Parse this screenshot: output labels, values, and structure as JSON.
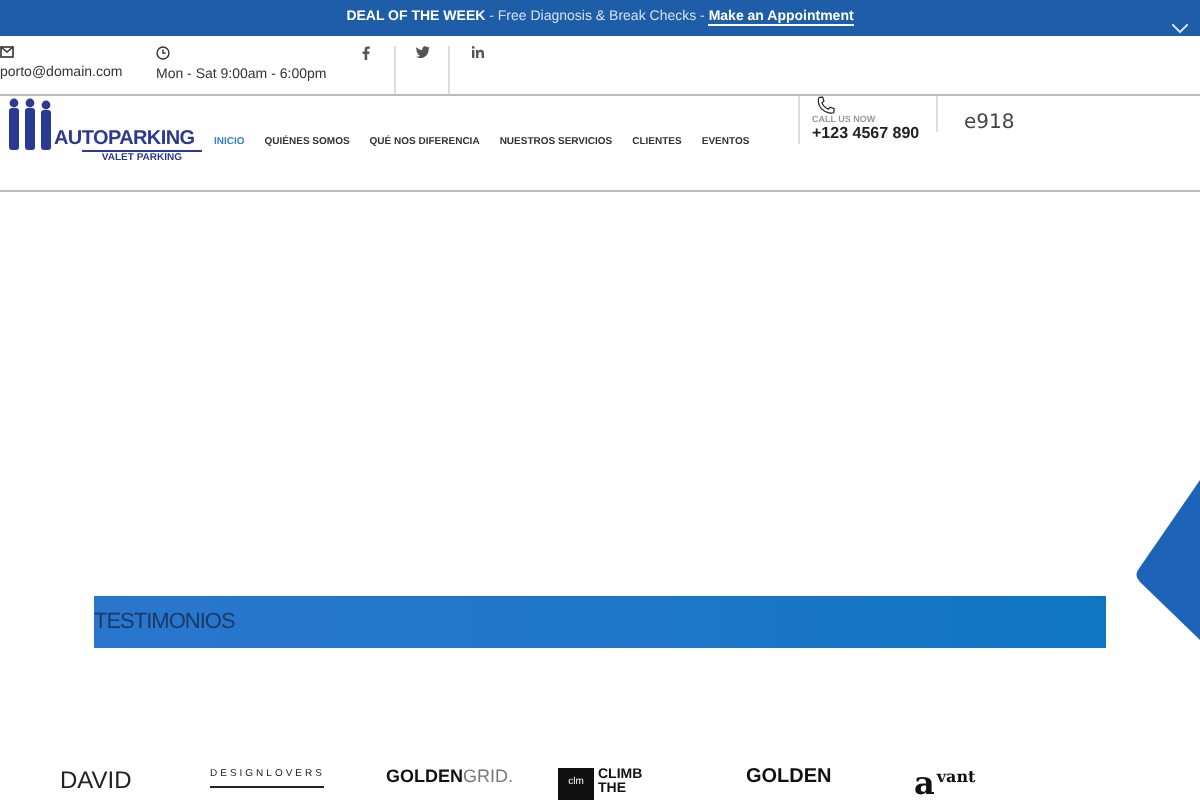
{
  "promo": {
    "label": "DEAL OF THE WEEK",
    "text": " - Free Diagnosis & Break Checks - ",
    "link": "Make an Appointment"
  },
  "contact": {
    "email": "porto@domain.com",
    "hours": "Mon - Sat 9:00am - 6:00pm"
  },
  "logo": {
    "name": "AUTOPARKING",
    "tagline": "VALET PARKING"
  },
  "nav": [
    {
      "label": "INICIO",
      "selected": true
    },
    {
      "label": "QUIÉNES SOMOS",
      "selected": false
    },
    {
      "label": "QUÉ NOS DIFERENCIA",
      "selected": false
    },
    {
      "label": "NUESTROS SERVICIOS",
      "selected": false
    },
    {
      "label": "CLIENTES",
      "selected": false
    },
    {
      "label": "EVENTOS",
      "selected": false
    }
  ],
  "call": {
    "label": "CALL US NOW",
    "phone": "+123 4567 890"
  },
  "extra": "e918",
  "section_title": "TESTIMONIOS",
  "client_logos": [
    {
      "kind": "plain",
      "text": "DAVID"
    },
    {
      "kind": "spaced",
      "text": "DESIGNLOVERS"
    },
    {
      "kind": "split",
      "text": "GOLDEN",
      "light": "GRID."
    },
    {
      "kind": "boxed",
      "badge": "clm",
      "text": "CLIMB",
      "line2": "THE"
    },
    {
      "kind": "plain-bold",
      "text": "GOLDEN"
    },
    {
      "kind": "serif",
      "badge": "a",
      "text": "vant"
    }
  ]
}
